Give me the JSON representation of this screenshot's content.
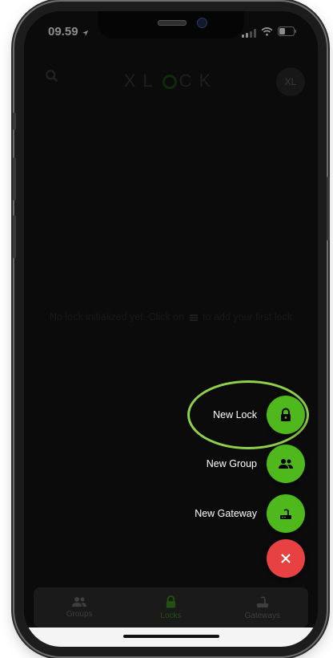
{
  "status_bar": {
    "time": "09.59"
  },
  "header": {
    "logo_text": "XLOCK",
    "avatar_initials": "XL"
  },
  "empty_state": {
    "text_before": "No lock initialized yet. Click on",
    "text_after": "to add your first lock"
  },
  "fab_menu": {
    "items": [
      {
        "label": "New Lock",
        "icon": "lock-icon"
      },
      {
        "label": "New Group",
        "icon": "group-icon"
      },
      {
        "label": "New Gateway",
        "icon": "router-icon"
      }
    ],
    "close_icon": "close-icon",
    "highlighted_item": "New Lock"
  },
  "tabs": [
    {
      "label": "Groups",
      "icon": "group-icon",
      "active": false
    },
    {
      "label": "Locks",
      "icon": "lock-icon",
      "active": true
    },
    {
      "label": "Gateways",
      "icon": "router-icon",
      "active": false
    }
  ],
  "colors": {
    "accent_green": "#4eb81c",
    "close_red": "#e84141",
    "highlight_ring": "#8fd14a",
    "background": "#141414"
  }
}
